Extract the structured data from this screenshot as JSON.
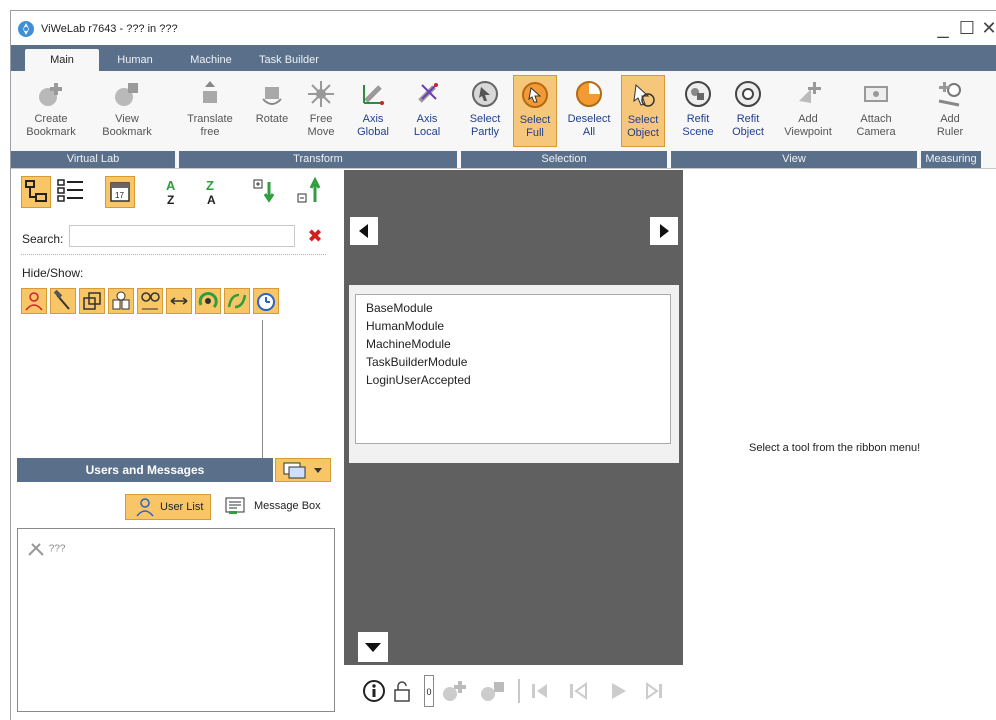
{
  "window": {
    "title": "ViWeLab r7643 - ??? in ???",
    "minimize": "_",
    "maximize": "☐",
    "close": "✕"
  },
  "tabs": [
    {
      "label": "Main",
      "active": true
    },
    {
      "label": "Human"
    },
    {
      "label": "Machine"
    },
    {
      "label": "Task Builder"
    }
  ],
  "ribbon": {
    "groups": [
      "Virtual Lab",
      "Transform",
      "Selection",
      "View",
      "Measuring"
    ],
    "buttons": {
      "create_bookmark": "Create\nBookmark",
      "view_bookmark": "View\nBookmark",
      "translate_free": "Translate\nfree",
      "rotate": "Rotate",
      "free_move": "Free\nMove",
      "axis_global": "Axis\nGlobal",
      "axis_local": "Axis\nLocal",
      "select_partly": "Select\nPartly",
      "select_full": "Select\nFull",
      "deselect_all": "Deselect\nAll",
      "select_object": "Select\nObject",
      "refit_scene": "Refit\nScene",
      "refit_object": "Refit\nObject",
      "add_viewpoint": "Add\nViewpoint",
      "attach_camera": "Attach\nCamera",
      "add_ruler": "Add\nRuler"
    }
  },
  "leftpanel": {
    "search_label": "Search:",
    "search_value": "",
    "hideshow_label": "Hide/Show:",
    "users_messages_title": "Users and Messages",
    "user_list_label": "User List",
    "message_box_label": "Message Box",
    "users": [
      "???"
    ]
  },
  "modules": [
    "BaseModule",
    "HumanModule",
    "MachineModule",
    "TaskBuilderModule",
    "LoginUserAccepted"
  ],
  "bottombar": {
    "zero_field": "0"
  },
  "rightpanel": {
    "hint": "Select a tool from the ribbon menu!"
  },
  "colors": {
    "accent_blue": "#5a6f8a",
    "selected_orange": "#f8c567",
    "panel_gray": "#606060"
  }
}
